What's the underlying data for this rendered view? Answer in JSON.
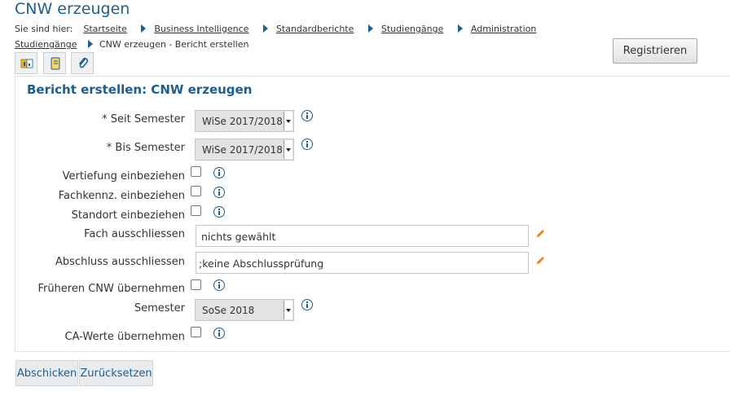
{
  "page": {
    "title": "CNW erzeugen"
  },
  "breadcrumb": {
    "prefix": "Sie sind hier:",
    "items": [
      "Startseite",
      "Business Intelligence",
      "Standardberichte",
      "Studiengänge",
      "Administration",
      "Studiengänge"
    ],
    "current": "CNW erzeugen - Bericht erstellen"
  },
  "header": {
    "register_label": "Registrieren"
  },
  "toolbar": {
    "icons": [
      "report-icon",
      "notebook-icon",
      "paperclip-icon"
    ]
  },
  "form": {
    "title": "Bericht erstellen: CNW erzeugen",
    "seit_semester": {
      "label": "* Seit Semester",
      "value": "WiSe 2017/2018"
    },
    "bis_semester": {
      "label": "* Bis Semester",
      "value": "WiSe 2017/2018"
    },
    "vertiefung": {
      "label": "Vertiefung einbeziehen",
      "checked": false
    },
    "fachkennz": {
      "label": "Fachkennz. einbeziehen",
      "checked": false
    },
    "standort": {
      "label": "Standort einbeziehen",
      "checked": false
    },
    "fach_ausschliessen": {
      "label": "Fach ausschliessen",
      "value": "nichts gewählt"
    },
    "abschluss_ausschliessen": {
      "label": "Abschluss ausschliessen",
      "value": ";keine Abschlussprüfung"
    },
    "frueheren_cnw": {
      "label": "Früheren CNW übernehmen",
      "checked": false
    },
    "semester": {
      "label": "Semester",
      "value": "SoSe 2018"
    },
    "ca_werte": {
      "label": "CA-Werte übernehmen",
      "checked": false
    }
  },
  "actions": {
    "submit_label": "Abschicken",
    "reset_label": "Zurücksetzen"
  },
  "colors": {
    "accent": "#1e5d8c",
    "edit_icon": "#e8821e"
  }
}
